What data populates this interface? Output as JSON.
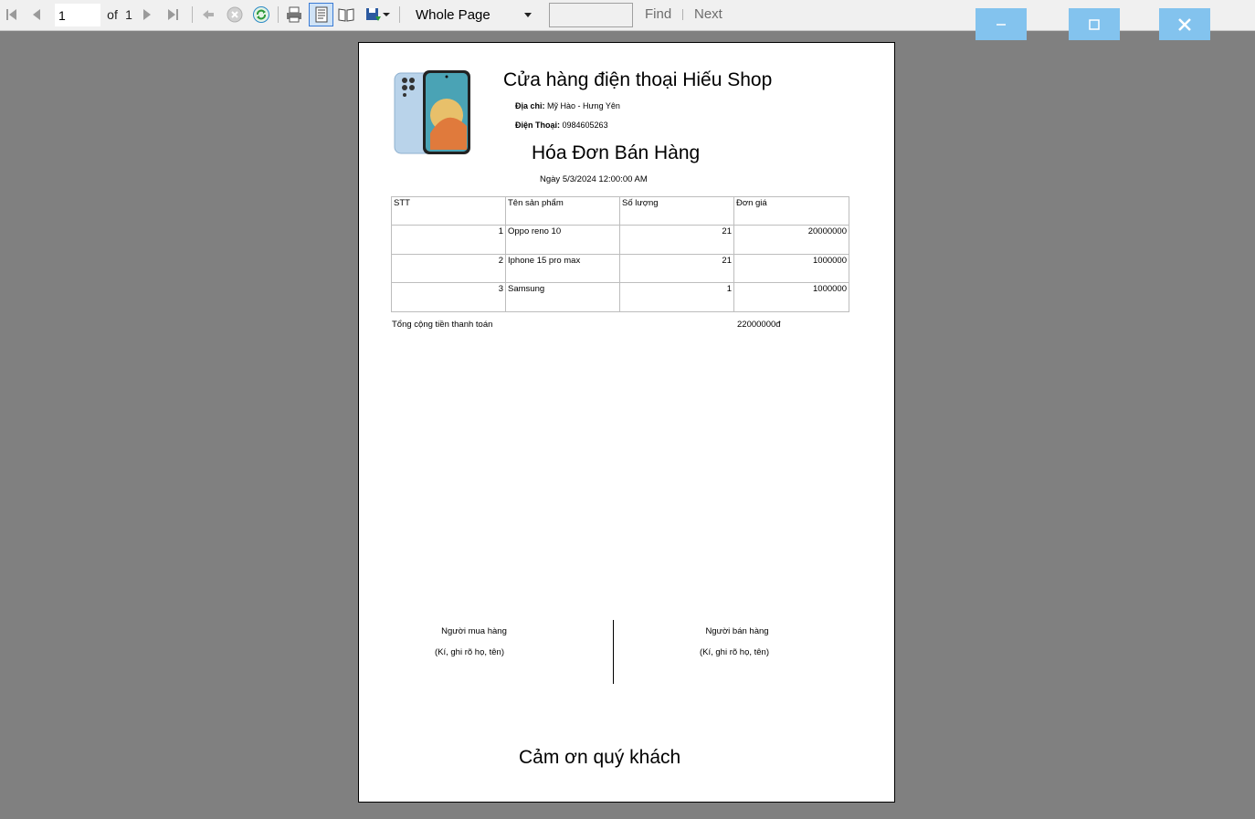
{
  "toolbar": {
    "current_page": "1",
    "of_label": "of",
    "total_pages": "1",
    "zoom_value": "Whole Page",
    "find_label": "Find",
    "next_label": "Next",
    "icons": [
      "first-page-icon",
      "previous-page-icon",
      "next-page-icon",
      "last-page-icon",
      "back-icon",
      "stop-icon",
      "refresh-icon",
      "print-icon",
      "print-layout-icon",
      "page-setup-icon",
      "export-icon"
    ]
  },
  "window": {
    "minimize": "–",
    "maximize": "□",
    "close": "✕"
  },
  "colors": {
    "window_button": "#83c3ee",
    "background": "#808080"
  },
  "report": {
    "shop_name": "Cửa hàng điện thoại Hiếu Shop",
    "address_label": "Địa chỉ:",
    "address_value": "Mỹ Hào - Hưng Yên",
    "phone_label": "Điện Thoại:",
    "phone_value": "0984605263",
    "title": "Hóa Đơn Bán Hàng",
    "date": "Ngày 5/3/2024 12:00:00 AM",
    "table": {
      "headers": [
        "STT",
        "Tên sản phẩm",
        "Số lượng",
        "Đơn giá"
      ],
      "rows": [
        [
          "1",
          "Oppo reno 10",
          "21",
          "20000000"
        ],
        [
          "2",
          "Iphone 15 pro max",
          "21",
          "1000000"
        ],
        [
          "3",
          "Samsung",
          "1",
          "1000000"
        ]
      ]
    },
    "total_label": "Tổng cộng tiền thanh toán",
    "total_value": "22000000đ",
    "buyer_label": "Người mua hàng",
    "buyer_note": "(Kí, ghi rõ họ, tên)",
    "seller_label": "Người bán hàng",
    "seller_note": "(Kí, ghi rõ họ, tên)",
    "thanks": "Cảm ơn quý khách"
  }
}
